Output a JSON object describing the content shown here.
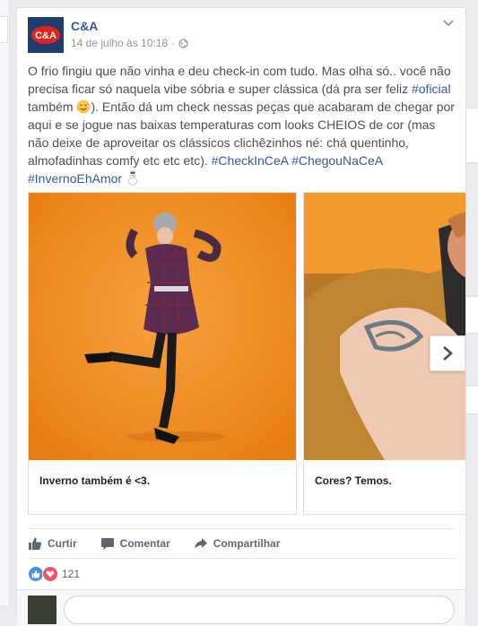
{
  "post": {
    "page_name": "C&A",
    "logo_text": "C&A",
    "timestamp": "14 de julho às 10:18",
    "text_part1": "O frio fingiu que não vinha e deu check-in com tudo. Mas olha só.. você não precisa ficar só naquela vibe sóbria e super clássica (dá pra ser feliz ",
    "hashtag_oficial": "#oficial",
    "text_part2": " também ",
    "text_part3": "). Então dá um check nessas peças que acabaram de chegar por aqui e se jogue nas baixas temperaturas com looks CHEIOS de cor (mas não deixe de aproveitar os clássicos clichêzinhos né: chá quentinho, almofadinhas comfy etc etc etc). ",
    "hashtag_checkin": "#CheckInCeA",
    "hashtag_chegou": "#ChegouNaCeA",
    "hashtag_inverno": "#InvernoEhAmor"
  },
  "carousel": {
    "items": [
      {
        "caption": "Inverno também é <3."
      },
      {
        "caption": "Cores? Temos."
      }
    ]
  },
  "actions": {
    "like": "Curtir",
    "comment": "Comentar",
    "share": "Compartilhar"
  },
  "reactions": {
    "count": "121"
  },
  "colors": {
    "link": "#365899",
    "logo_bg": "#1f3d6e",
    "logo_red": "#e2231a",
    "orange_bg": "#f08a1c"
  }
}
